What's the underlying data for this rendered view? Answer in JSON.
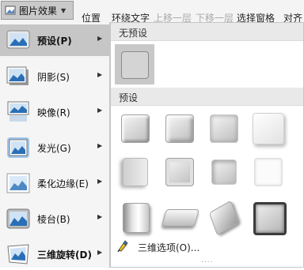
{
  "ribbon": {
    "picture_effects_label": "图片效果",
    "position_label": "位置",
    "wrap_text_label": "环绕文字",
    "bring_forward_label": "上移一层",
    "send_backward_label": "下移一层",
    "selection_pane_label": "选择窗格",
    "align_label": "对齐"
  },
  "menu": {
    "items": [
      {
        "label": "预设(P)",
        "icon": "preset-icon",
        "active": true
      },
      {
        "label": "阴影(S)",
        "icon": "shadow-icon"
      },
      {
        "label": "映像(R)",
        "icon": "reflection-icon"
      },
      {
        "label": "发光(G)",
        "icon": "glow-icon"
      },
      {
        "label": "柔化边缘(E)",
        "icon": "soft-edges-icon"
      },
      {
        "label": "棱台(B)",
        "icon": "bevel-icon"
      },
      {
        "label": "三维旋转(D)",
        "icon": "3d-rotation-icon"
      }
    ]
  },
  "gallery": {
    "no_preset_header": "无预设",
    "presets_header": "预设",
    "three_d_options_label": "三维选项(O)...",
    "grip": "....",
    "accent": "#2a6fb6"
  }
}
